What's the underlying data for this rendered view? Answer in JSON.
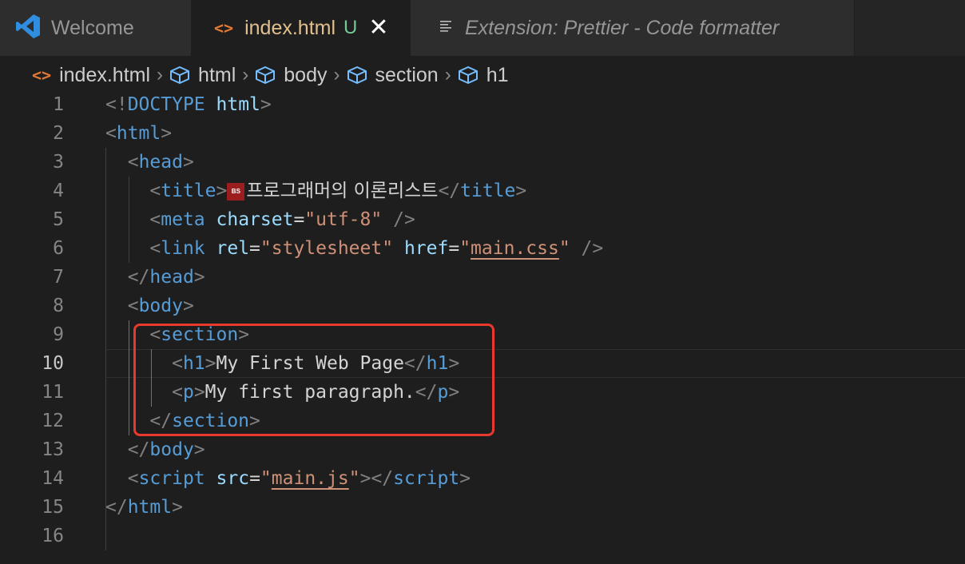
{
  "tabs": [
    {
      "label": "Welcome",
      "icon": "vscode-logo-icon"
    },
    {
      "label": "index.html",
      "badge": "U",
      "icon": "code-icon",
      "active": true
    },
    {
      "label": "Extension: Prettier - Code formatter",
      "icon": "list-icon"
    }
  ],
  "breadcrumb": [
    "index.html",
    "html",
    "body",
    "section",
    "h1"
  ],
  "editor": {
    "active_line": 10,
    "line_numbers": [
      "1",
      "2",
      "3",
      "4",
      "5",
      "6",
      "7",
      "8",
      "9",
      "10",
      "11",
      "12",
      "13",
      "14",
      "15",
      "16"
    ],
    "title_text": "프로그래머의 이론리스트",
    "favicon_text": "BS",
    "h1_text": "My First Web Page",
    "p_text": "My first paragraph."
  },
  "colors": {
    "tag": "#569cd6",
    "attribute": "#9cdcfe",
    "string": "#ce9178",
    "highlight_box": "#e8392f",
    "untracked": "#73c991"
  }
}
